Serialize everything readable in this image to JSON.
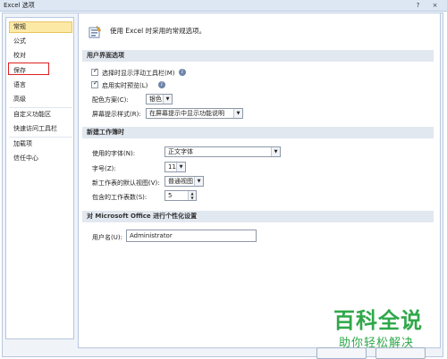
{
  "window": {
    "title": "Excel 选项",
    "help": "?",
    "close": "×"
  },
  "sidebar": {
    "items": [
      {
        "label": "常规"
      },
      {
        "label": "公式"
      },
      {
        "label": "校对"
      },
      {
        "label": "保存"
      },
      {
        "label": "语言"
      },
      {
        "label": "高级"
      },
      {
        "label": "自定义功能区"
      },
      {
        "label": "快速访问工具栏"
      },
      {
        "label": "加载项"
      },
      {
        "label": "信任中心"
      }
    ]
  },
  "main": {
    "intro": "使用 Excel 时采用的常规选项。",
    "ui_section": {
      "header": "用户界面选项",
      "show_mini_toolbar": "选择时显示浮动工具栏(M)",
      "live_preview": "启用实时预览(L)",
      "color_scheme_label": "配色方案(C):",
      "color_scheme_value": "银色",
      "screentip_label": "屏幕提示样式(R):",
      "screentip_value": "在屏幕提示中显示功能说明"
    },
    "new_workbook_section": {
      "header": "新建工作簿时",
      "font_label": "使用的字体(N):",
      "font_value": "正文字体",
      "size_label": "字号(Z):",
      "size_value": "11",
      "view_label": "新工作表的默认视图(V):",
      "view_value": "普通视图",
      "sheets_label": "包含的工作表数(S):",
      "sheets_value": "5"
    },
    "personalize_section": {
      "header": "对 Microsoft Office 进行个性化设置",
      "username_label": "用户名(U):",
      "username_value": "Administrator"
    }
  },
  "watermark": {
    "title": "百科全说",
    "subtitle": "助你轻松解决"
  },
  "colors": {
    "highlight": "#e02020",
    "active_nav": "#fde9a6",
    "watermark": "#2fa84a",
    "section_bg": "#e2e8f0"
  }
}
